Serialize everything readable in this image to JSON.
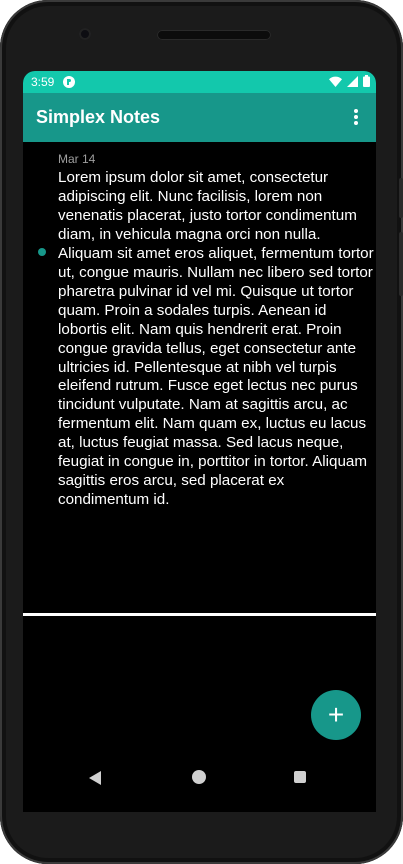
{
  "status_bar": {
    "time": "3:59",
    "app_icon": "notes-app-icon",
    "icons": [
      "wifi-icon",
      "cell-signal-icon",
      "battery-icon"
    ]
  },
  "app_bar": {
    "title": "Simplex Notes",
    "menu_icon": "more-vert-icon"
  },
  "notes": [
    {
      "date": "Mar 14",
      "body": "Lorem ipsum dolor sit amet, consectetur adipiscing elit. Nunc facilisis, lorem non venenatis placerat, justo tortor condimentum diam, in vehicula magna orci non nulla. Aliquam sit amet eros aliquet, fermentum tortor ut, congue mauris. Nullam nec libero sed tortor pharetra pulvinar id vel mi. Quisque ut tortor quam. Proin a sodales turpis. Aenean id lobortis elit. Nam quis hendrerit erat. Proin congue gravida tellus, eget consectetur ante ultricies id. Pellentesque at nibh vel turpis eleifend rutrum. Fusce eget lectus nec purus tincidunt vulputate. Nam at sagittis arcu, ac fermentum elit. Nam quam ex, luctus eu lacus at, luctus feugiat massa. Sed lacus neque, feugiat in congue in, porttitor in tortor. Aliquam sagittis eros arcu, sed placerat ex condimentum id."
    }
  ],
  "fab": {
    "label": "+",
    "icon": "add-icon"
  },
  "nav_bar": {
    "icons": [
      "back-icon",
      "home-icon",
      "recents-icon"
    ]
  },
  "colors": {
    "status_bar": "#13c8ac",
    "app_bar": "#17978a",
    "accent": "#17978a",
    "background": "#000000"
  }
}
